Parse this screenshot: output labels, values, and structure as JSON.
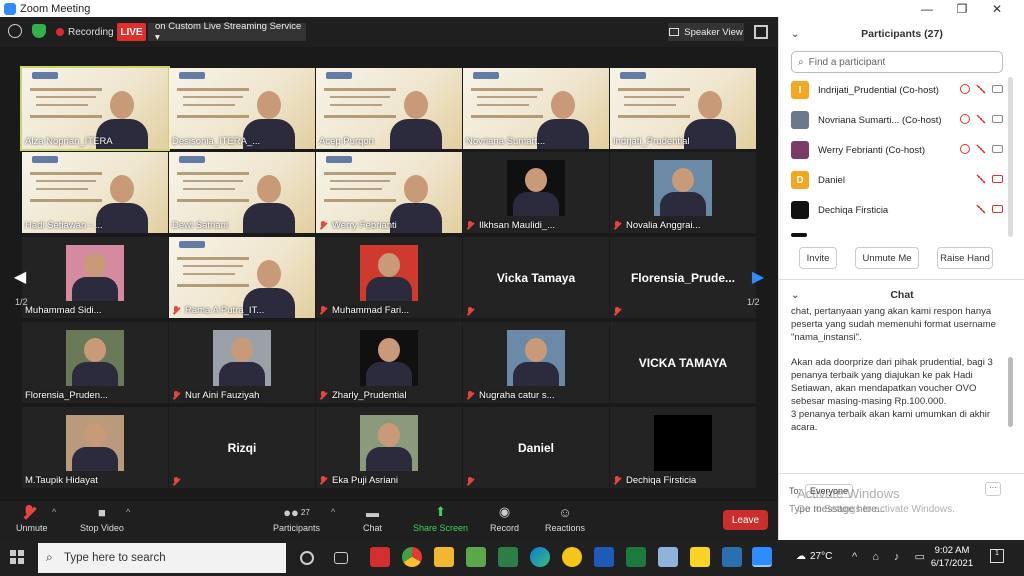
{
  "window": {
    "title": "Zoom Meeting",
    "minimize": "—",
    "maximize": "❐",
    "close": "✕"
  },
  "topbar": {
    "recording": "Recording",
    "live": "LIVE",
    "stream": "on Custom Live Streaming Service ▾",
    "speaker_view": "Speaker View"
  },
  "tiles": [
    {
      "name": "Alza Noprian_ITERA",
      "type": "banner",
      "muted": false
    },
    {
      "name": "Desisonia_ITERA_...",
      "type": "banner",
      "muted": false
    },
    {
      "name": "Acep Purqon",
      "type": "banner",
      "muted": false
    },
    {
      "name": "Novriana Sumart...",
      "type": "banner",
      "muted": false
    },
    {
      "name": "Indrjati_Prudential",
      "type": "banner",
      "muted": false
    },
    {
      "name": "Hadi Setiawan - ...",
      "type": "banner",
      "muted": false
    },
    {
      "name": "Dewi Satriani",
      "type": "banner",
      "muted": false
    },
    {
      "name": "Werry Febrianti",
      "type": "banner",
      "muted": true
    },
    {
      "name": "Ilkhsan Maulidi_...",
      "type": "photo",
      "muted": true
    },
    {
      "name": "Novalia Anggrai...",
      "type": "photo",
      "muted": true
    },
    {
      "name": "Muhammad Sidi...",
      "type": "photo",
      "muted": false
    },
    {
      "name": "Rama A Putra_IT...",
      "type": "banner",
      "muted": true
    },
    {
      "name": "Muhammad Fari...",
      "type": "photo",
      "muted": true
    },
    {
      "name": "Vicka Tamaya",
      "type": "text",
      "muted": true
    },
    {
      "name": "Florensia_Prude...",
      "type": "text",
      "muted": true
    },
    {
      "name": "Florensia_Pruden...",
      "type": "photo",
      "muted": false
    },
    {
      "name": "Nur Aini Fauziyah",
      "type": "photo",
      "muted": true
    },
    {
      "name": "Zharly_Prudential",
      "type": "photo",
      "muted": true
    },
    {
      "name": "Nugraha catur s...",
      "type": "photo",
      "muted": true
    },
    {
      "name": "VICKA TAMAYA",
      "type": "text",
      "muted": false
    },
    {
      "name": "M.Taupik Hidayat",
      "type": "photo",
      "muted": false
    },
    {
      "name": "Rizqi",
      "type": "text",
      "muted": true
    },
    {
      "name": "Eka Puji Asriani",
      "type": "photo",
      "muted": true
    },
    {
      "name": "Daniel",
      "type": "text",
      "muted": true
    },
    {
      "name": "Dechiqa Firsticia",
      "type": "photo",
      "muted": true
    }
  ],
  "pager": {
    "left": "1/2",
    "right": "1/2"
  },
  "toolbar": {
    "unmute": "Unmute",
    "stop_video": "Stop Video",
    "participants": "Participants",
    "participants_count": "27",
    "chat": "Chat",
    "share_screen": "Share Screen",
    "record": "Record",
    "reactions": "Reactions",
    "leave": "Leave"
  },
  "participants_panel": {
    "title": "Participants (27)",
    "search_placeholder": "Find a participant",
    "list": [
      {
        "name": "Indrijati_Prudential (Co-host)",
        "initial": "I",
        "color": "#f5a623"
      },
      {
        "name": "Novriana Sumarti...  (Co-host)",
        "initial": "",
        "color": "#6a7a8a"
      },
      {
        "name": "Werry Febrianti (Co-host)",
        "initial": "",
        "color": "#7a3a6a"
      },
      {
        "name": "Daniel",
        "initial": "D",
        "color": "#f5a623"
      },
      {
        "name": "Dechiqa Firsticia",
        "initial": "",
        "color": "#111111"
      }
    ],
    "invite": "Invite",
    "unmute_me": "Unmute Me",
    "raise_hand": "Raise Hand"
  },
  "chat_panel": {
    "title": "Chat",
    "messages": [
      "chat, pertanyaan yang akan kami respon hanya peserta yang sudah memenuhi format username \"nama_instansi\".",
      "Akan ada doorprize dari pihak prudential, bagi 3 penanya terbaik yang diajukan ke pak Hadi Setiawan, akan mendapatkan voucher OVO sebesar masing-masing Rp.100.000.\n3 penanya terbaik akan kami umumkan di akhir acara."
    ],
    "to_label": "To:",
    "to_value": "Everyone",
    "placeholder": "Type message here...",
    "watermark_title": "Activate Windows",
    "watermark_sub": "Go to Settings to activate Windows."
  },
  "taskbar": {
    "search": "Type here to search",
    "weather": "27°C",
    "time": "9:02 AM",
    "date": "6/17/2021"
  }
}
